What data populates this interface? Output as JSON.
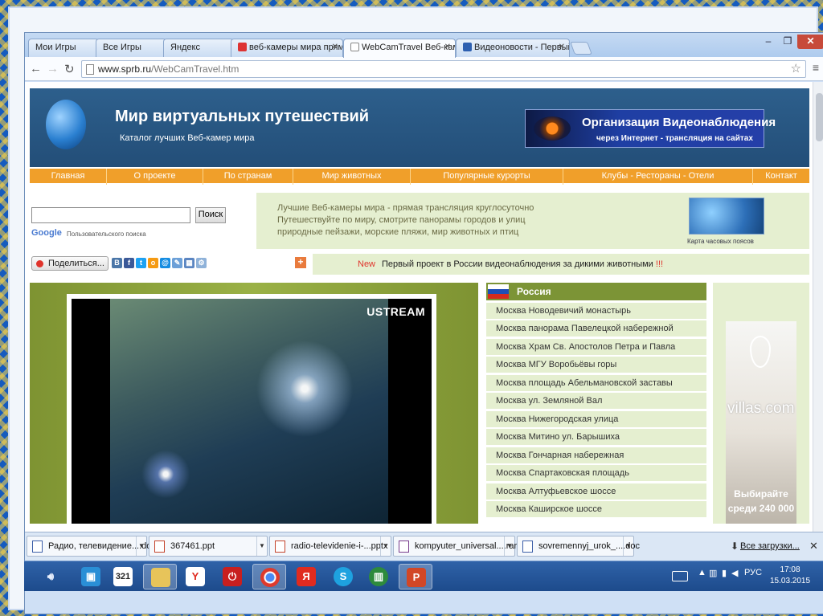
{
  "browser": {
    "tabs": [
      {
        "label": "Мои Игры"
      },
      {
        "label": "Все Игры"
      },
      {
        "label": "Яндекс"
      },
      {
        "label": "веб-камеры мира прям"
      },
      {
        "label": "WebCamTravel Веб-кам"
      },
      {
        "label": "Видеоновости - Первый"
      }
    ],
    "url_host": "www.sprb.ru",
    "url_path": "/WebCamTravel.htm"
  },
  "site": {
    "title": "Мир виртуальных путешествий",
    "subtitle": "Каталог лучших Веб-камер мира",
    "banner_title": "Организация Видеонаблюдения",
    "banner_sub": "через Интернет - трансляция на сайтах",
    "nav": [
      "Главная",
      "О проекте",
      "По странам",
      "Мир животных",
      "Популярные курорты",
      "Клубы  - Рестораны - Отели",
      "Контакт"
    ],
    "search_button": "Поиск",
    "google_logo": "Google",
    "google_sub": "Пользовательского поиска",
    "desc": [
      "Лучшие Веб-камеры мира - прямая трансляция круглосуточно",
      "Путешествуйте по миру, смотрите панорамы городов и улиц",
      "природные пейзажи, морские пляжи, мир животных и птиц"
    ],
    "map_caption": "Карта часовых поясов",
    "share_label": "Поделиться...",
    "news_new": "New",
    "news_text": "Первый проект в России видеонаблюдения за дикими животными",
    "news_bang": "!!!",
    "video_logo": "USTREAM",
    "cams_head": "Россия",
    "cams": [
      "Москва Новодевичий монастырь",
      "Москва панорама Павелецкой набережной",
      "Москва Храм Св. Апостолов Петра и Павла",
      "Москва МГУ Воробьёвы горы",
      "Москва площадь Абельмановской заставы",
      "Москва ул. Земляной Вал",
      "Москва Нижегородская улица",
      "Москва Митино ул. Барышиха",
      "Москва Гончарная набережная",
      "Москва Спартаковская площадь",
      "Москва Алтуфьевское шоссе",
      "Москва Каширское шоссе"
    ],
    "ad_brand": "villas.com",
    "ad_promo_1": "Выбирайте",
    "ad_promo_2": "среди 240 000"
  },
  "downloads": {
    "items": [
      {
        "name": "Радио, телевидение....doc"
      },
      {
        "name": "367461.ppt"
      },
      {
        "name": "radio-televidenie-i-...pptx"
      },
      {
        "name": "kompyuter_universal....rar"
      },
      {
        "name": "sovremennyj_urok_....doc"
      }
    ],
    "all_label": "Все загрузки..."
  },
  "taskbar": {
    "lang": "РУС",
    "time": "17:08",
    "date": "15.03.2015",
    "calendar_day": "321"
  }
}
